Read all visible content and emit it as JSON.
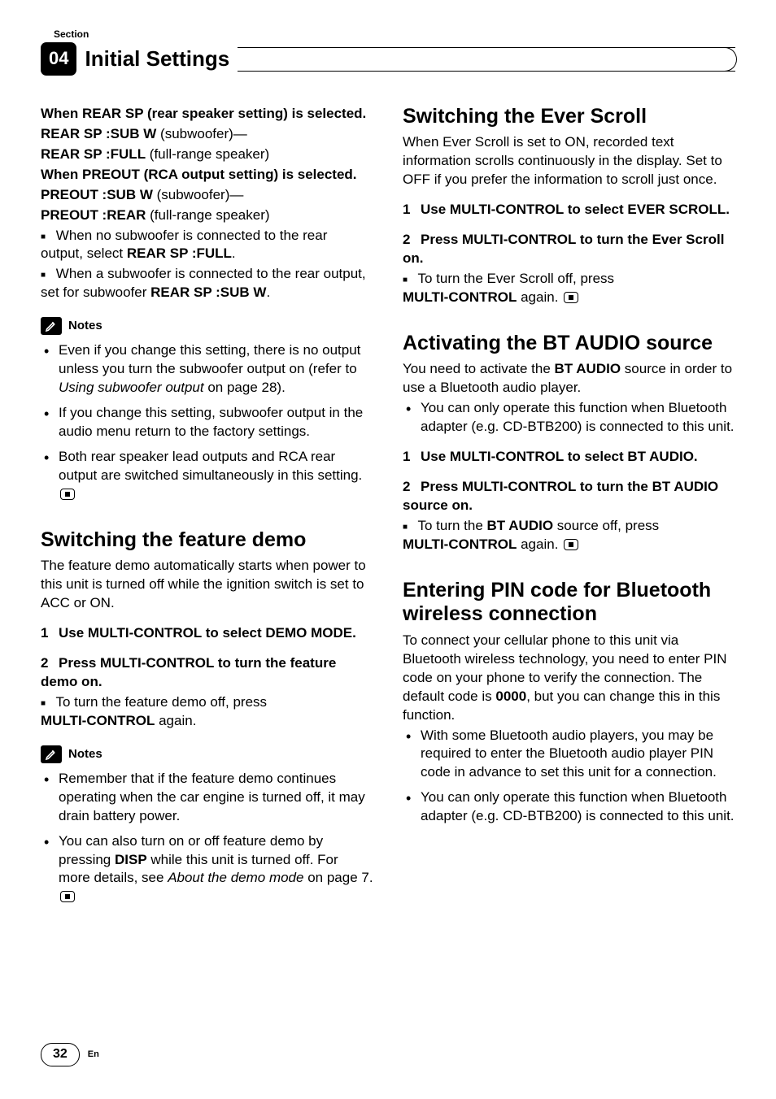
{
  "header": {
    "section_label": "Section",
    "section_number": "04",
    "chapter_title": "Initial Settings"
  },
  "left": {
    "rear_sp_intro": "When REAR SP (rear speaker setting) is selected.",
    "rear_sp_sub_label": "REAR SP :SUB W",
    "rear_sp_sub_desc": " (subwoofer)—",
    "rear_sp_full_label": "REAR SP :FULL",
    "rear_sp_full_desc": " (full-range speaker)",
    "preout_intro_a": "When PREOUT",
    "preout_intro_b": " (RCA output setting) is selected.",
    "preout_sub_label": "PREOUT :SUB W",
    "preout_sub_desc": " (subwoofer)—",
    "preout_rear_label": "PREOUT :REAR",
    "preout_rear_desc": " (full-range speaker)",
    "sq1_a": "When no subwoofer is connected to the rear output, select ",
    "sq1_b": "REAR SP :FULL",
    "sq1_c": ".",
    "sq2_a": "When a subwoofer is connected to the rear output, set for subwoofer ",
    "sq2_b": "REAR SP :SUB W",
    "sq2_c": ".",
    "notes_label": "Notes",
    "note1_a": "Even if you change this setting, there is no output unless you turn the subwoofer output on (refer to ",
    "note1_b": "Using subwoofer output",
    "note1_c": " on page 28).",
    "note2": "If you change this setting, subwoofer output in the audio menu return to the factory settings.",
    "note3": "Both rear speaker lead outputs and RCA rear output are switched simultaneously in this setting.",
    "h2_demo": "Switching the feature demo",
    "demo_intro": "The feature demo automatically starts when power to this unit is turned off while the ignition switch is set to ACC or ON.",
    "demo_step1": "Use MULTI-CONTROL to select DEMO MODE.",
    "demo_step2": "Press MULTI-CONTROL to turn the feature demo on.",
    "demo_sub_a": "To turn the feature demo off, press ",
    "demo_sub_b": "MULTI-CONTROL",
    "demo_sub_c": " again.",
    "notes2_label": "Notes",
    "dnote1": "Remember that if the feature demo continues operating when the car engine is turned off, it may drain battery power.",
    "dnote2_a": "You can also turn on or off feature demo by pressing ",
    "dnote2_b": "DISP",
    "dnote2_c": " while this unit is turned off. For more details, see ",
    "dnote2_d": "About the demo mode",
    "dnote2_e": " on page 7."
  },
  "right": {
    "h2_ever": "Switching the Ever Scroll",
    "ever_intro": "When Ever Scroll is set to ON, recorded text information scrolls continuously in the display. Set to OFF if you prefer the information to scroll just once.",
    "ever_step1": "Use MULTI-CONTROL to select EVER SCROLL.",
    "ever_step2": "Press MULTI-CONTROL to turn the Ever Scroll on.",
    "ever_sub_a": "To turn the Ever Scroll off, press ",
    "ever_sub_b": "MULTI-CONTROL",
    "ever_sub_c": " again.",
    "h2_bt_a": "Activating the ",
    "h2_bt_b": "BT AUDIO",
    "h2_bt_c": " source",
    "bt_intro_a": "You need to activate the ",
    "bt_intro_b": "BT AUDIO",
    "bt_intro_c": " source in order to use a Bluetooth audio player.",
    "bt_bullet": "You can only operate this function when Bluetooth adapter (e.g. CD-BTB200) is connected to this unit.",
    "bt_step1": "Use MULTI-CONTROL to select BT AUDIO.",
    "bt_step2": "Press MULTI-CONTROL to turn the BT AUDIO source on.",
    "bt_sub_a": "To turn the ",
    "bt_sub_b": "BT AUDIO",
    "bt_sub_c": " source off, press ",
    "bt_sub_d": "MULTI-CONTROL",
    "bt_sub_e": " again.",
    "h2_pin": "Entering PIN code for Bluetooth wireless connection",
    "pin_intro_a": "To connect your cellular phone to this unit via Bluetooth wireless technology, you need to enter PIN code on your phone to verify the connection. The default code is ",
    "pin_intro_b": "0000",
    "pin_intro_c": ", but you can change this in this function.",
    "pin_b1": "With some Bluetooth audio players, you may be required to enter the Bluetooth audio player PIN code in advance to set this unit for a connection.",
    "pin_b2": "You can only operate this function when Bluetooth adapter (e.g. CD-BTB200) is connected to this unit."
  },
  "footer": {
    "page": "32",
    "lang": "En"
  },
  "steps": {
    "n1": "1",
    "n2": "2"
  }
}
